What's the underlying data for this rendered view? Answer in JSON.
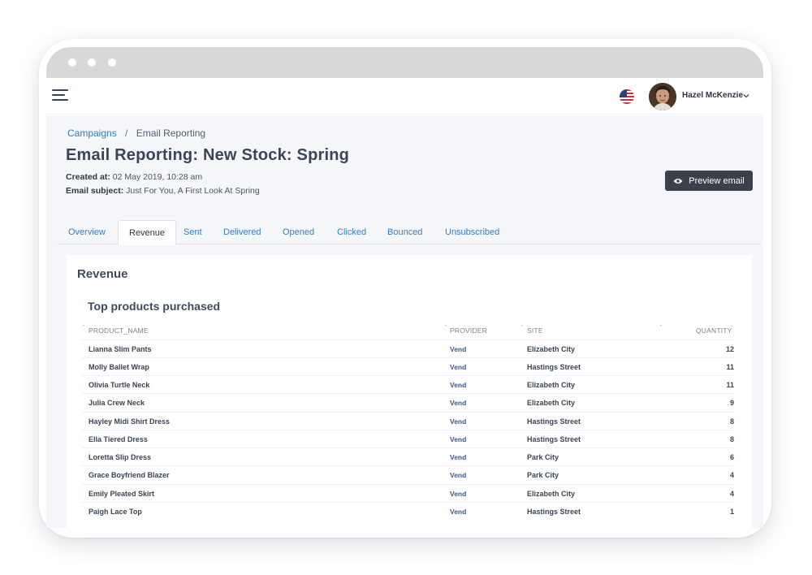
{
  "header": {
    "user_name": "Hazel McKenzie",
    "flag_icon": "us-flag-icon",
    "menu_icon": "hamburger-menu-icon"
  },
  "breadcrumb": {
    "parent": "Campaigns",
    "separator": "/",
    "current": "Email Reporting"
  },
  "page": {
    "title": "Email Reporting: New Stock: Spring",
    "created_label": "Created at:",
    "created_value": "02 May 2019, 10:28 am",
    "subject_label": "Email subject:",
    "subject_value": "Just For You, A First Look At Spring",
    "preview_button": "Preview email"
  },
  "tabs": [
    "Overview",
    "Revenue",
    "Sent",
    "Delivered",
    "Opened",
    "Clicked",
    "Bounced",
    "Unsubscribed"
  ],
  "active_tab": "Revenue",
  "card": {
    "title": "Revenue",
    "section_title": "Top products purchased",
    "columns": [
      "PRODUCT_NAME",
      "PROVIDER",
      "SITE",
      "QUANTITY"
    ],
    "rows": [
      {
        "product": "Lianna Slim Pants",
        "provider": "Vend",
        "site": "Elizabeth City",
        "quantity": "12"
      },
      {
        "product": "Molly Ballet Wrap",
        "provider": "Vend",
        "site": "Hastings Street",
        "quantity": "11"
      },
      {
        "product": "Olivia Turtle Neck",
        "provider": "Vend",
        "site": "Elizabeth City",
        "quantity": "11"
      },
      {
        "product": "Julia Crew Neck",
        "provider": "Vend",
        "site": "Elizabeth City",
        "quantity": "9"
      },
      {
        "product": "Hayley Midi Shirt Dress",
        "provider": "Vend",
        "site": "Hastings Street",
        "quantity": "8"
      },
      {
        "product": "Ella Tiered Dress",
        "provider": "Vend",
        "site": "Hastings Street",
        "quantity": "8"
      },
      {
        "product": "Loretta Slip Dress",
        "provider": "Vend",
        "site": "Park City",
        "quantity": "6"
      },
      {
        "product": "Grace Boyfriend Blazer",
        "provider": "Vend",
        "site": "Park City",
        "quantity": "4"
      },
      {
        "product": "Emily Pleated Skirt",
        "provider": "Vend",
        "site": "Elizabeth City",
        "quantity": "4"
      },
      {
        "product": "Paigh Lace Top",
        "provider": "Vend",
        "site": "Hastings Street",
        "quantity": "1"
      }
    ]
  },
  "colors": {
    "link": "#2f7dd1",
    "button_bg": "#3b4049",
    "page_bg": "#f4f6fa",
    "browser_chrome": "#d8d8d8"
  }
}
